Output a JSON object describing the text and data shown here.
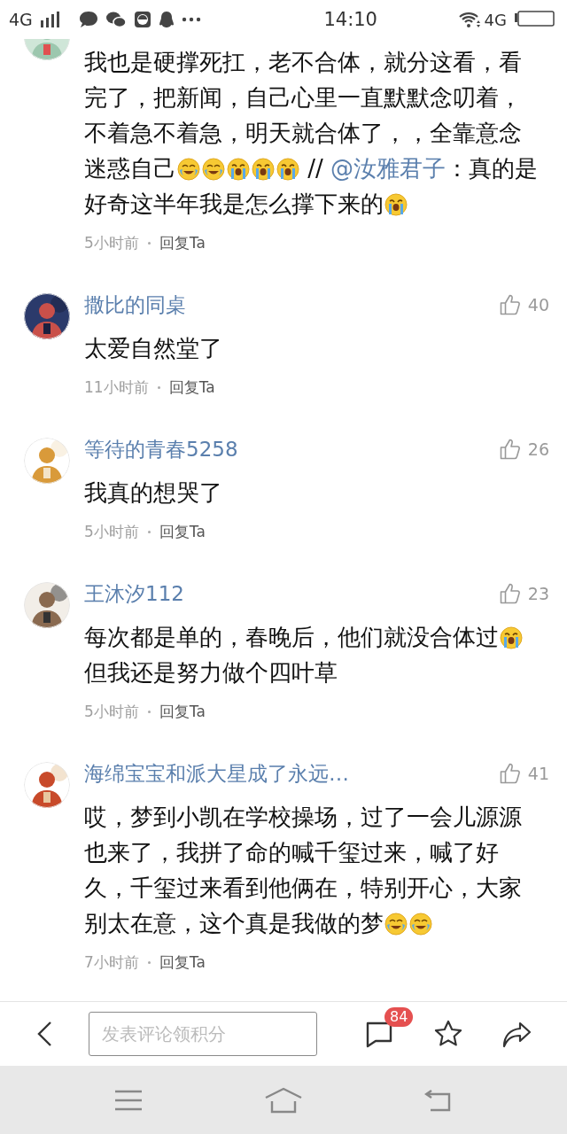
{
  "status_bar": {
    "network_left": "4G",
    "time": "14:10",
    "network_right": "4G"
  },
  "comments": [
    {
      "content": [
        {
          "kind": "text",
          "text": "我也是硬撑死扛，老不合体，就分这看，看完了，把新闻，自己心里一直默默念叨着，不着急不着急，明天就合体了，，全靠意念迷惑自己"
        },
        {
          "kind": "laugh"
        },
        {
          "kind": "laugh"
        },
        {
          "kind": "sob"
        },
        {
          "kind": "sob"
        },
        {
          "kind": "sob"
        },
        {
          "kind": "text",
          "text": " // "
        },
        {
          "kind": "mention",
          "text": "@汝雅君子"
        },
        {
          "kind": "text",
          "text": "：真的是好奇这半年我是怎么撑下来的"
        },
        {
          "kind": "sob"
        }
      ],
      "time": "5小时前",
      "reply": "回复Ta"
    },
    {
      "name": "撒比的同桌",
      "likes": "40",
      "content": [
        {
          "kind": "text",
          "text": "太爱自然堂了"
        }
      ],
      "time": "11小时前",
      "reply": "回复Ta"
    },
    {
      "name": "等待的青春5258",
      "likes": "26",
      "content": [
        {
          "kind": "text",
          "text": "我真的想哭了"
        }
      ],
      "time": "5小时前",
      "reply": "回复Ta"
    },
    {
      "name": "王沐汐112",
      "likes": "23",
      "content": [
        {
          "kind": "text",
          "text": "每次都是单的，春晚后，他们就没合体过"
        },
        {
          "kind": "sob"
        },
        {
          "kind": "text",
          "text": "但我还是努力做个四叶草"
        }
      ],
      "time": "5小时前",
      "reply": "回复Ta"
    },
    {
      "name": "海绵宝宝和派大星成了永远…",
      "likes": "41",
      "content": [
        {
          "kind": "text",
          "text": "哎，梦到小凯在学校操场，过了一会儿源源也来了，我拼了命的喊千玺过来，喊了好久，千玺过来看到他俩在，特别开心，大家别太在意，这个真是我做的梦"
        },
        {
          "kind": "laugh"
        },
        {
          "kind": "laugh"
        }
      ],
      "time": "7小时前",
      "reply": "回复Ta"
    }
  ],
  "comment_bar": {
    "placeholder": "发表评论领积分",
    "comment_count": "84"
  }
}
